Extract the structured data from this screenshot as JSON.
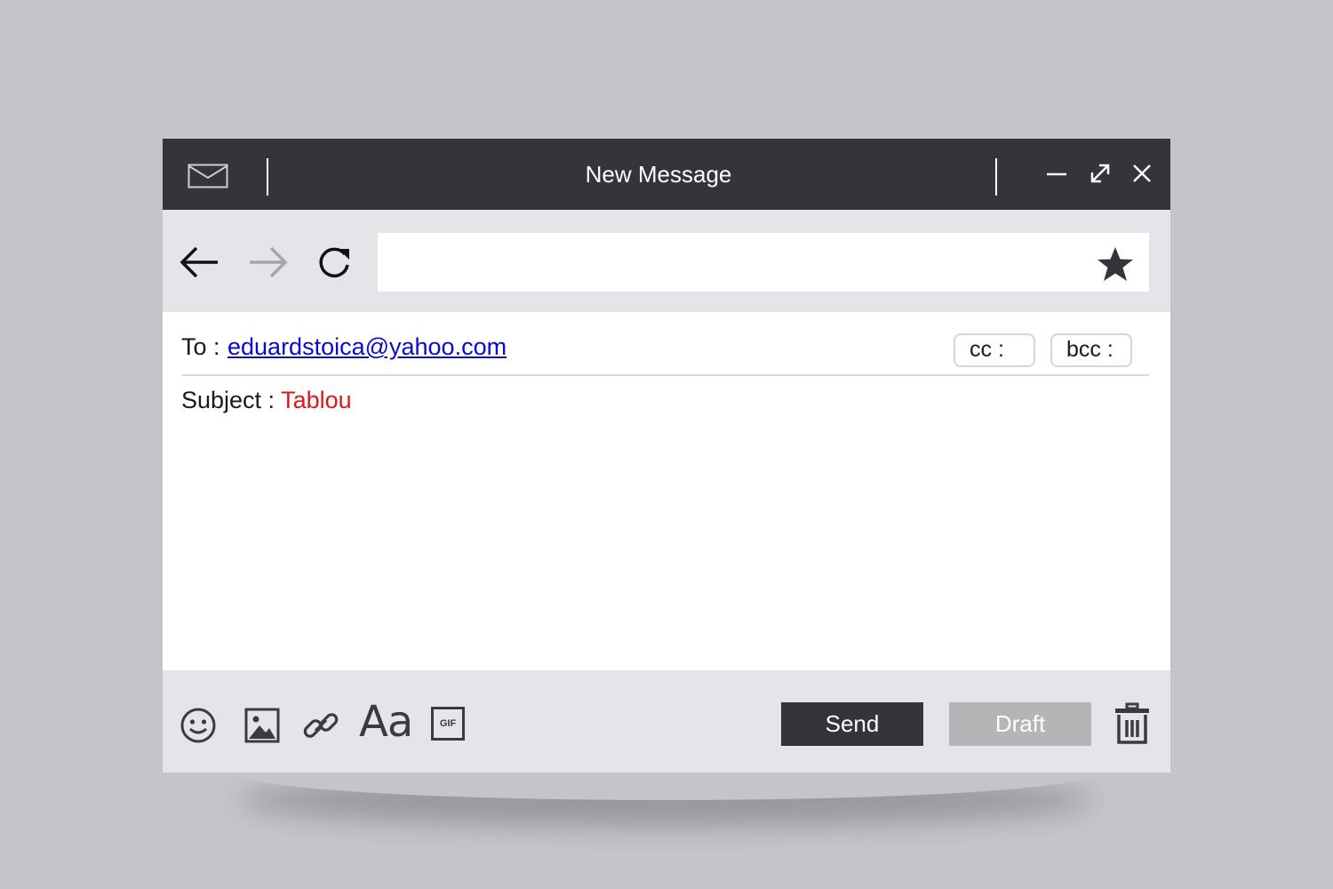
{
  "window": {
    "title": "New Message"
  },
  "titlebar": {
    "icons": [
      "mail-icon",
      "minimize-icon",
      "expand-icon",
      "close-icon"
    ]
  },
  "navbar": {
    "icons": [
      "back-arrow-icon",
      "forward-arrow-icon",
      "refresh-icon",
      "star-icon"
    ],
    "url_value": ""
  },
  "compose": {
    "to_label": "To :",
    "to_value": "eduardstoica@yahoo.com",
    "cc_label": "cc :",
    "bcc_label": "bcc :",
    "subject_label": "Subject :",
    "subject_value": "Tablou"
  },
  "toolbar": {
    "icons": [
      "emoji-icon",
      "image-icon",
      "link-icon",
      "gif-icon",
      "trash-icon"
    ],
    "format_label": "Aa",
    "gif_label": "GIF",
    "send_label": "Send",
    "draft_label": "Draft"
  },
  "colors": {
    "titlebar": "#353439",
    "panel": "#e4e4e9",
    "background": "#c4c4c9",
    "link": "#0a0acc",
    "subject": "#e0141c",
    "draft_button": "#b5b5b8"
  }
}
